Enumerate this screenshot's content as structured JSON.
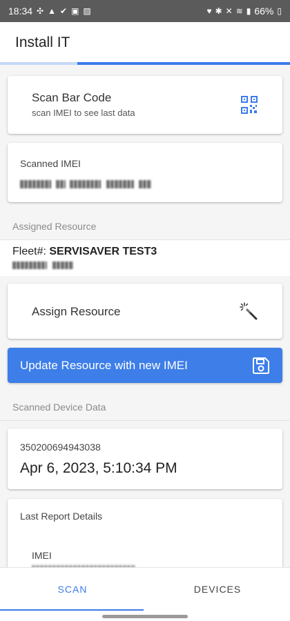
{
  "status_bar": {
    "time": "18:34",
    "battery": "66%"
  },
  "app": {
    "title": "Install IT"
  },
  "scan_card": {
    "title": "Scan Bar Code",
    "subtitle": "scan IMEI to see last data",
    "icon": "qr-code-icon"
  },
  "imei_card": {
    "label": "Scanned IMEI"
  },
  "assigned_resource": {
    "section_label": "Assigned Resource",
    "fleet_prefix": "Fleet#: ",
    "fleet_name": "SERVISAVER TEST3"
  },
  "assign_button": {
    "label": "Assign Resource",
    "icon": "magic-wand-icon"
  },
  "update_button": {
    "label": "Update Resource with new IMEI",
    "icon": "save-icon"
  },
  "device_data": {
    "section_label": "Scanned Device Data",
    "device_id": "350200694943038",
    "datetime": "Apr 6, 2023, 5:10:34 PM"
  },
  "report": {
    "title": "Last Report Details",
    "imei_label": "IMEI"
  },
  "nav": {
    "scan": "SCAN",
    "devices": "DEVICES"
  },
  "colors": {
    "accent": "#3a7bea",
    "button": "#3d7ee8",
    "status_bar": "#5b5b5b"
  }
}
